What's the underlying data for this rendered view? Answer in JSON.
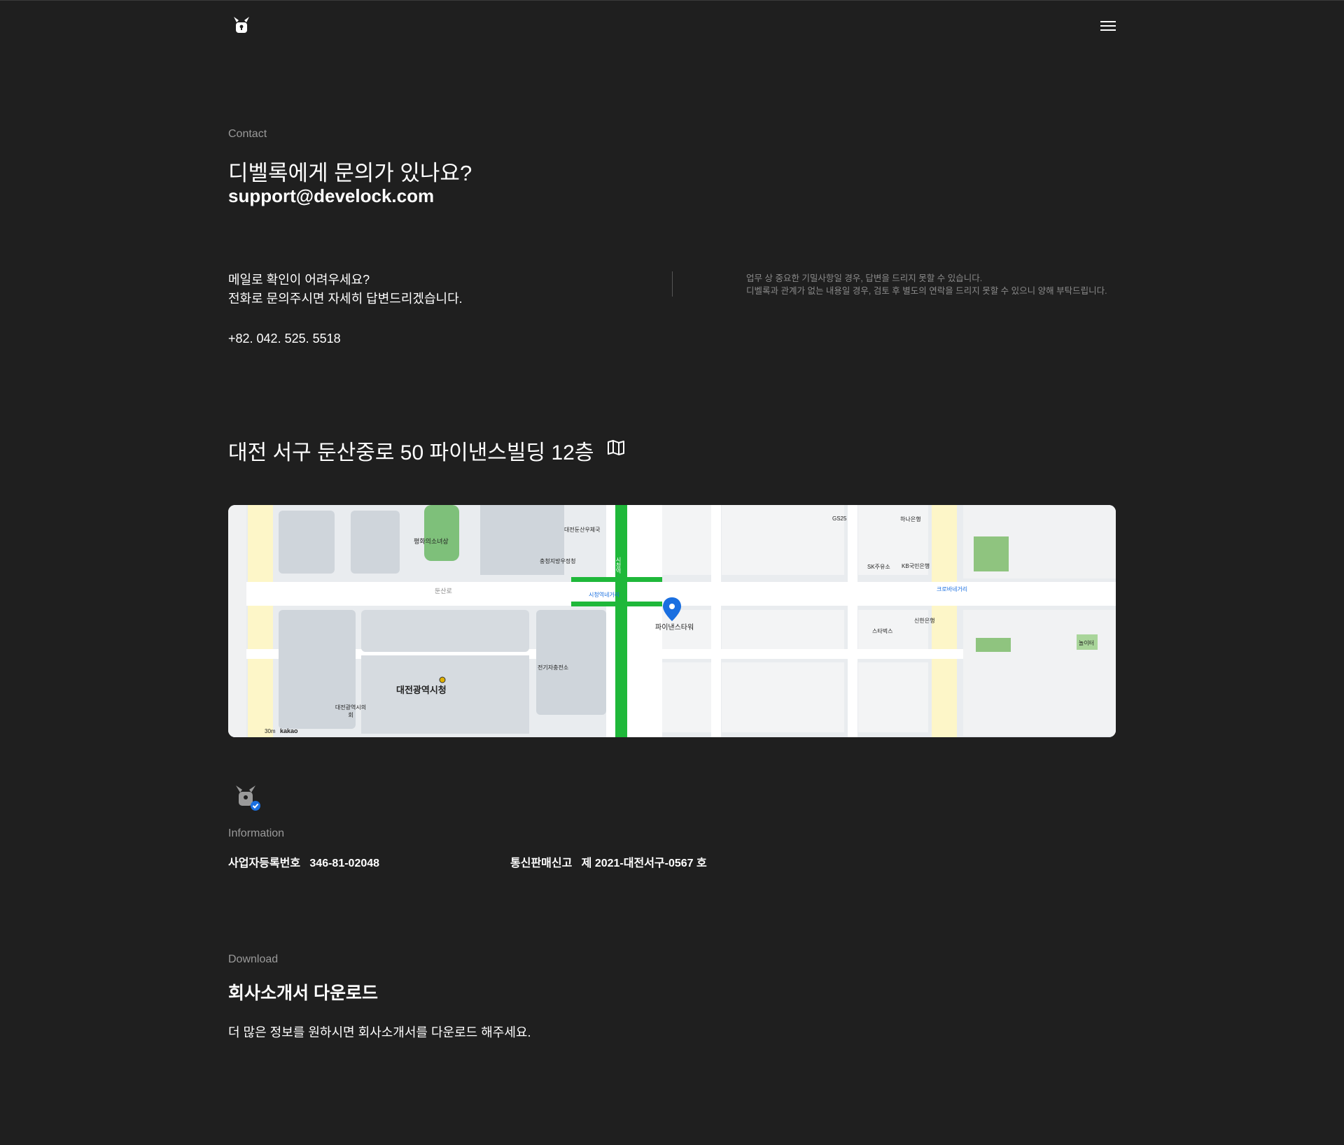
{
  "header": {
    "logo_icon": "lock-mascot-icon",
    "menu_icon": "hamburger-menu-icon"
  },
  "contact": {
    "label": "Contact",
    "title": "디벨록에게 문의가 있나요?",
    "email": "support@develock.com",
    "phone_prompt_line1": "메일로 확인이 어려우세요?",
    "phone_prompt_line2": "전화로 문의주시면 자세히 답변드리겠습니다.",
    "phone": "+82. 042. 525. 5518",
    "note_line1": "업무 상 중요한 기밀사항일 경우, 답변을 드리지 못할 수 있습니다.",
    "note_line2": "디벨록과 관계가 없는 내용일 경우, 검토 후 별도의 연락을 드리지 못할 수 있으니 양해 부탁드립니다."
  },
  "location": {
    "address": "대전 서구 둔산중로 50 파이낸스빌딩 12층",
    "map_icon": "map-icon",
    "map_labels": {
      "city_hall": "대전광역시청",
      "marker": "파이낸스타워",
      "road1": "둔산로",
      "road2": "시청역네거리",
      "station": "시청역",
      "kakao": "kakao",
      "scale": "30m",
      "peace": "평화의소녀상",
      "post": "대전둔산우체국",
      "police": "충청지방우정청",
      "gs": "GS25",
      "kb": "KB국민은행",
      "sk": "SK주유소",
      "starbucks": "스타벅스",
      "shinhan": "신한은행",
      "hana": "하나은행",
      "crossroad": "크로바네거리",
      "council": "대전광역시의회",
      "energy": "전기자충전소",
      "play": "놀이터"
    }
  },
  "information": {
    "badge_icon": "verified-lock-badge-icon",
    "label": "Information",
    "biz_label": "사업자등록번호",
    "biz_value": "346-81-02048",
    "sales_label": "통신판매신고",
    "sales_value": "제 2021-대전서구-0567 호"
  },
  "download": {
    "label": "Download",
    "title": "회사소개서 다운로드",
    "desc": "더 많은 정보를 원하시면 회사소개서를 다운로드 해주세요."
  },
  "colors": {
    "background": "#1f1f1f",
    "muted": "#9a9a9a",
    "road_green": "#1fb83a",
    "marker_blue": "#1a6fe0"
  }
}
